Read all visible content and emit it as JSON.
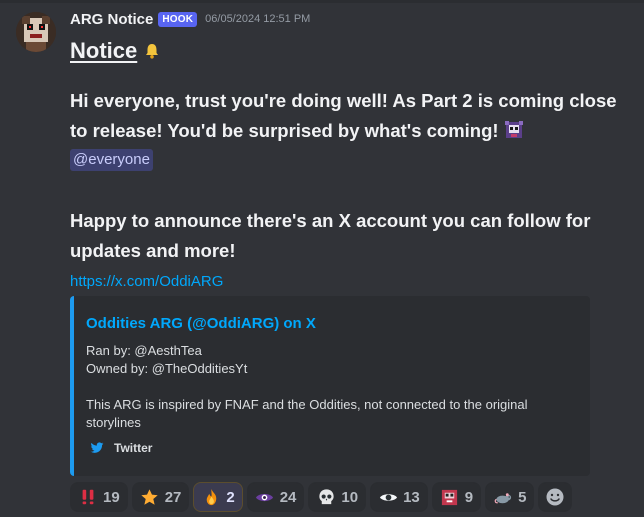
{
  "author": {
    "username": "ARG Notice",
    "badge": "HOOK",
    "timestamp": "06/05/2024 12:51 PM"
  },
  "message": {
    "title": "Notice",
    "paragraph_1": "Hi everyone, trust you're doing well! As Part 2 is coming close to release! You'd be surprised by what's coming!",
    "mention": "@everyone",
    "paragraph_2": "Happy to announce there's an X account you can follow for updates and more!",
    "link": "https://x.com/OddiARG"
  },
  "embed": {
    "title": "Oddities ARG (@OddiARG) on X",
    "line_1": "Ran by: @AesthTea",
    "line_2": "Owned by: @TheOdditiesYt",
    "line_3": "This ARG is inspired by FNAF and the Oddities, not connected to the original storylines",
    "footer": "Twitter",
    "accent_color": "#1d9bf0"
  },
  "reactions": [
    {
      "emoji": "double-exclamation-icon",
      "count": "19",
      "active": false
    },
    {
      "emoji": "star-icon",
      "count": "27",
      "active": false
    },
    {
      "emoji": "fire-icon",
      "count": "2",
      "active": true
    },
    {
      "emoji": "eye-icon",
      "count": "24",
      "active": false
    },
    {
      "emoji": "skull-icon",
      "count": "10",
      "active": false
    },
    {
      "emoji": "eye-icon",
      "count": "13",
      "active": false
    },
    {
      "emoji": "custom-character-icon",
      "count": "9",
      "active": false
    },
    {
      "emoji": "rat-icon",
      "count": "5",
      "active": false
    }
  ],
  "colors": {
    "background": "#313338",
    "mention_bg": "#5865f2",
    "link": "#00a8fc"
  }
}
